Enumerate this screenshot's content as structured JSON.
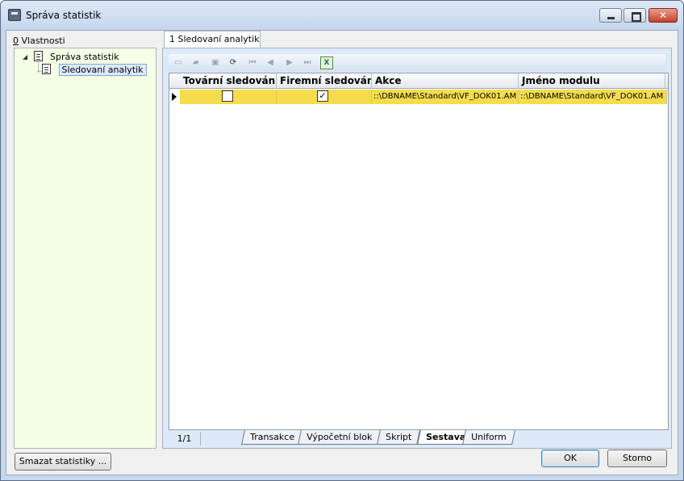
{
  "window": {
    "title": "Správa statistik"
  },
  "left_panel": {
    "label_key": "0",
    "label_text": " Vlastnosti",
    "tree": [
      {
        "label": "Správa statistik",
        "expanded": true
      },
      {
        "label": "Sledovaní analytik",
        "selected": true
      }
    ]
  },
  "right_panel": {
    "tab_label": "1 Sledovaní analytik",
    "toolbar": [
      "new-icon",
      "open-icon",
      "delete-icon",
      "refresh-icon",
      "first-record-icon",
      "prev-record-icon",
      "next-record-icon",
      "last-record-icon",
      "excel-export-icon"
    ],
    "grid": {
      "columns": [
        "Tovární sledování",
        "Firemní sledování",
        "Akce",
        "Jméno modulu"
      ],
      "rows": [
        {
          "factory_tracking": false,
          "company_tracking": true,
          "action": "::\\DBNAME\\Standard\\VF_DOK01.AM",
          "module": "::\\DBNAME\\Standard\\VF_DOK01.AM"
        }
      ]
    },
    "status": {
      "pager": "1/1",
      "sheet_tabs": [
        "Transakce",
        "Výpočetní blok",
        "Skript",
        "Sestava",
        "Uniform"
      ],
      "active_tab": "Sestava"
    }
  },
  "buttons": {
    "clear_stats": "Smazat statistiky ...",
    "ok": "OK",
    "cancel": "Storno"
  },
  "colors": {
    "selected_row": "#f4dd4c",
    "tree_background": "#f5ffe6"
  }
}
